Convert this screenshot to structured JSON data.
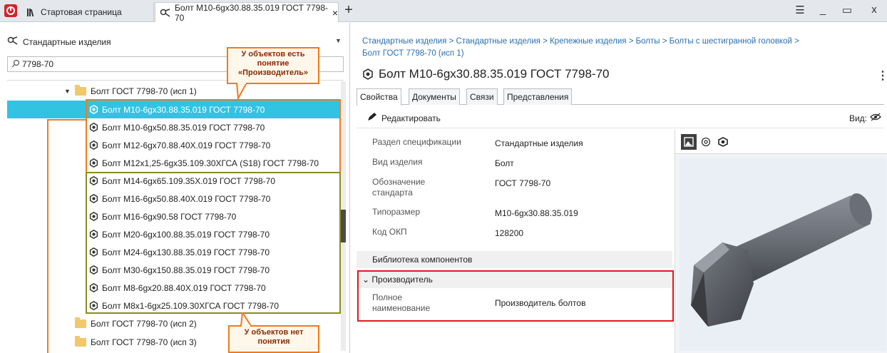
{
  "tabs": {
    "start_label": "Стартовая страница",
    "active_label": "Болт М10-6gx30.88.35.019 ГОСТ 7798-70",
    "close": "×",
    "new": "+"
  },
  "window": {
    "menu": "☰",
    "minimize": "_",
    "maximize": "▭",
    "close": "x"
  },
  "left_panel": {
    "header": "Стандартные изделия",
    "search_value": "7798-70",
    "tree": {
      "group1": "Болт ГОСТ 7798-70 (исп 1)",
      "items": [
        "Болт М10-6gx30.88.35.019 ГОСТ 7798-70",
        "Болт М10-6gx50.88.35.019 ГОСТ 7798-70",
        "Болт М12-6gx70.88.40Х.019 ГОСТ 7798-70",
        "Болт М12х1,25-6gx35.109.30ХГСА (S18) ГОСТ 7798-70",
        "Болт М14-6gx65.109.35Х.019 ГОСТ 7798-70",
        "Болт М16-6gx50.88.40Х.019 ГОСТ 7798-70",
        "Болт М16-6gx90.58 ГОСТ 7798-70",
        "Болт М20-6gx100.88.35.019 ГОСТ 7798-70",
        "Болт М24-6gx130.88.35.019 ГОСТ 7798-70",
        "Болт М30-6gx150.88.35.019 ГОСТ 7798-70",
        "Болт М8-6gx20.88.40Х.019 ГОСТ 7798-70",
        "Болт М8х1-6gx25.109.30ХГСА ГОСТ 7798-70"
      ],
      "group2": "Болт ГОСТ 7798-70 (исп 2)",
      "group3": "Болт ГОСТ 7798-70 (исп 3)"
    }
  },
  "callouts": {
    "has_manufacturer": [
      "У объектов есть",
      "понятие",
      "«Производитель»"
    ],
    "no_manufacturer": [
      "У объектов нет",
      "понятия"
    ]
  },
  "right_panel": {
    "breadcrumb_line1": "Стандартные изделия > Стандартные изделия > Крепежные изделия > Болты > Болты с шестигранной головкой >",
    "breadcrumb_line2": "Болт ГОСТ 7798-70 (исп 1)",
    "title": "Болт М10-6gx30.88.35.019 ГОСТ 7798-70",
    "tabs": [
      "Свойства",
      "Документы",
      "Связи",
      "Представления"
    ],
    "edit_label": "Редактировать",
    "view_label": "Вид:",
    "properties": [
      {
        "key": "Раздел спецификации",
        "value": "Стандартные изделия"
      },
      {
        "key": "Вид изделия",
        "value": "Болт"
      },
      {
        "key": "Обозначение стандарта",
        "value": "ГОСТ 7798-70"
      },
      {
        "key": "Типоразмер",
        "value": "М10-6gx30.88.35.019"
      },
      {
        "key": "Код ОКП",
        "value": "128200"
      }
    ],
    "section_library": "Библиотека компонентов",
    "section_manufacturer": "Производитель",
    "manufacturer_prop": {
      "key": "Полное наименование",
      "value": "Производитель болтов"
    }
  },
  "colors": {
    "selection": "#32c3e3",
    "orange_box": "#f07a1c",
    "olive_box": "#8a8d1c",
    "red_box": "#e3171f",
    "link": "#2a6fb0"
  }
}
